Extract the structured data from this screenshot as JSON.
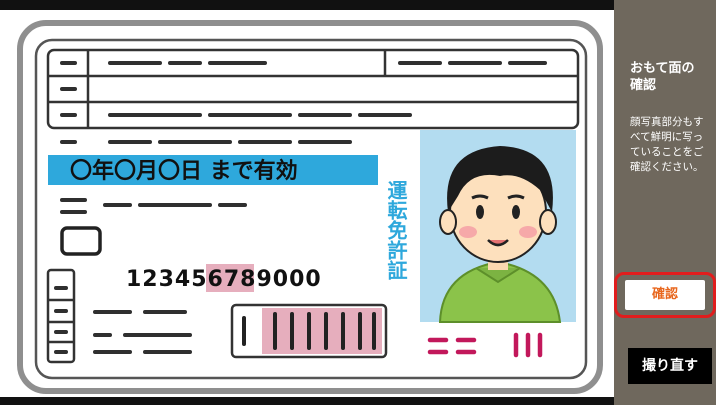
{
  "panel": {
    "title": "おもて面の\n確認",
    "message": "顔写真部分もすべて鮮明に写っていることをご確認ください。"
  },
  "buttons": {
    "confirm_label": "確認",
    "retake_label": "撮り直す"
  },
  "card": {
    "expiry_text": "〇年〇月〇日 まで有効",
    "license_number": "123456789000",
    "vertical_label": "運転免許証",
    "icons": [
      "person-photo-icon"
    ]
  },
  "colors": {
    "panel_bg": "#6f685d",
    "confirm_border": "#e11d1d",
    "confirm_text": "#e8671e",
    "expiry_band": "#2ea8dc",
    "highlight_pink": "#e6aebd"
  }
}
